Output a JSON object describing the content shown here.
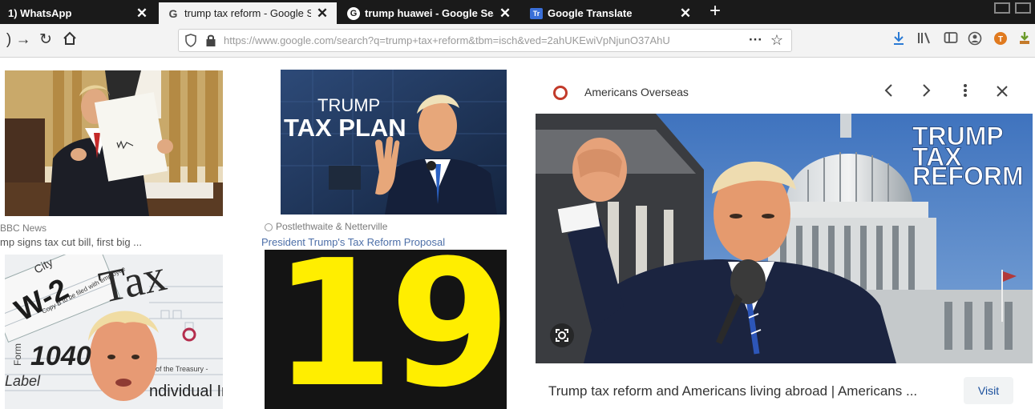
{
  "tabs": [
    {
      "label": "1) WhatsApp",
      "close": "✕",
      "icon": "whatsapp-icon"
    },
    {
      "label": "trump tax reform - Google Sea",
      "close": "✕",
      "icon": "google-icon",
      "favicon_text": "G"
    },
    {
      "label": "trump huawei - Google Search",
      "close": "✕",
      "icon": "google-icon",
      "favicon_text": "G"
    },
    {
      "label": "Google Translate",
      "close": "✕",
      "icon": "translate-icon",
      "favicon_text": "Tr"
    }
  ],
  "new_tab": "+",
  "nav": {
    "url": "https://www.google.com/search?q=trump+tax+reform&tbm=isch&ved=2ahUKEwiVpNjunO37AhU",
    "more": "···",
    "star": "☆"
  },
  "results": [
    {
      "source": "BBC News",
      "title": "mp signs tax cut bill, first big ..."
    },
    {
      "source": "Postlethwaite & Netterville",
      "title": "President Trump's Tax Reform Proposal",
      "image_title_1": "TRUMP",
      "image_title_2": "TAX PLAN"
    },
    {
      "image_words": [
        "W-2",
        "City",
        "Copy B to be filed with employee",
        "Tax",
        "1040",
        "Label",
        "Form",
        "of the Treasury -",
        "ndividual Inc"
      ]
    },
    {
      "image_number": "19"
    }
  ],
  "panel": {
    "site": "Americans Overseas",
    "hero_text": [
      "TRUMP",
      "TAX",
      "REFORM"
    ],
    "title": "Trump tax reform and Americans living abroad | Americans ...",
    "visit": "Visit"
  },
  "colors": {
    "tab_bg": "#1a1a1a",
    "active_tab_bg": "#f3f3f3",
    "toolbar_bg": "#f3f3f3",
    "blue_sky": "#4d7fc4",
    "yellow_number": "#ffee00",
    "link_blue": "#1a4f9c"
  }
}
